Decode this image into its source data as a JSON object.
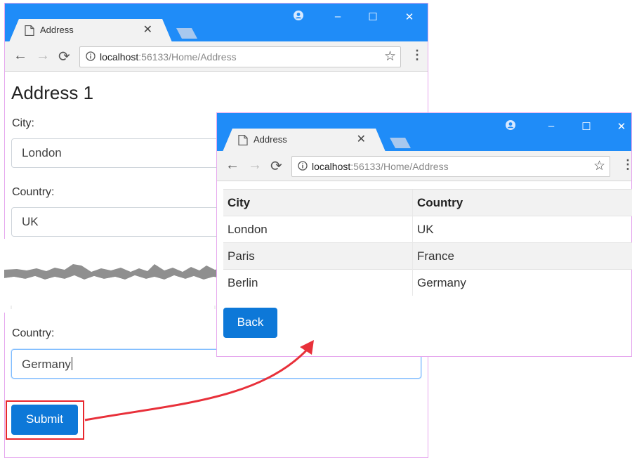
{
  "left_window": {
    "tab_title": "Address",
    "url_host": "localhost",
    "url_rest": ":56133/Home/Address",
    "heading": "Address 1",
    "city_label": "City:",
    "city_value": "London",
    "country_label": "Country:",
    "country_value": "UK",
    "country2_label": "Country:",
    "country2_value": "Germany",
    "submit_label": "Submit"
  },
  "right_window": {
    "tab_title": "Address",
    "url_host": "localhost",
    "url_rest": ":56133/Home/Address",
    "table": {
      "headers": [
        "City",
        "Country"
      ],
      "rows": [
        [
          "London",
          "UK"
        ],
        [
          "Paris",
          "France"
        ],
        [
          "Berlin",
          "Germany"
        ]
      ]
    },
    "back_label": "Back"
  },
  "colors": {
    "titlebar": "#1f8cf8",
    "primary_button": "#0d78d8",
    "highlight_box": "#e8262d",
    "arrow": "#e8303a"
  }
}
